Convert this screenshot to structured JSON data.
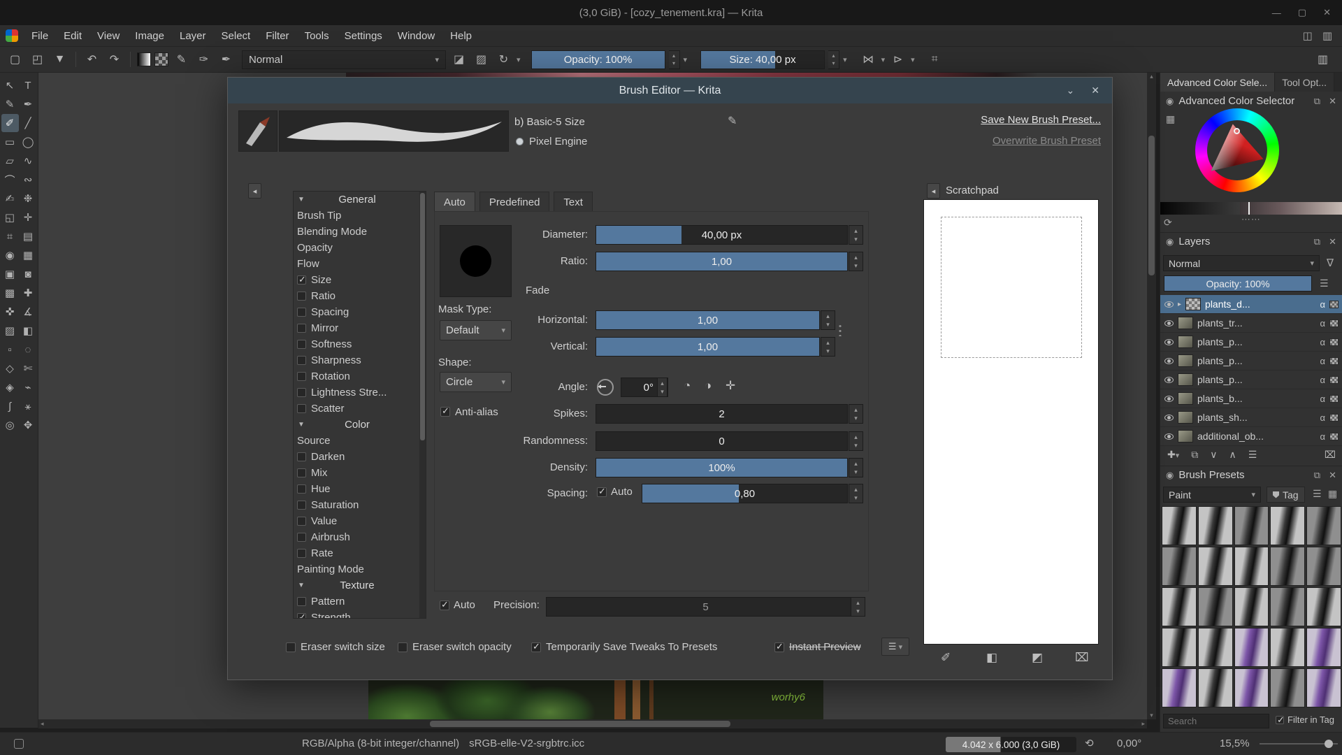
{
  "colors": {
    "accent_blue": "#54789e",
    "selection_blue": "#4a6d8e",
    "dialog_titlebar": "#35444e"
  },
  "window": {
    "title": "(3,0 GiB) - [cozy_tenement.kra] — Krita"
  },
  "menu_bar": {
    "items": [
      "File",
      "Edit",
      "View",
      "Image",
      "Layer",
      "Select",
      "Filter",
      "Tools",
      "Settings",
      "Window",
      "Help"
    ]
  },
  "toolbar": {
    "blending_mode_value": "Normal",
    "opacity_slider": "Opacity: 100%",
    "size_slider": "Size: 40,00 px"
  },
  "toolbox": {
    "tools": [
      {
        "name": "select-shapes",
        "glyph": "↖"
      },
      {
        "name": "text",
        "glyph": "T"
      },
      {
        "name": "edit-shapes",
        "glyph": "✎"
      },
      {
        "name": "calligraphy",
        "glyph": "✒"
      },
      {
        "name": "freehand-brush",
        "glyph": "✐",
        "selected": true
      },
      {
        "name": "line",
        "glyph": "╱"
      },
      {
        "name": "rectangle",
        "glyph": "▭"
      },
      {
        "name": "ellipse",
        "glyph": "◯"
      },
      {
        "name": "polygon",
        "glyph": "▱"
      },
      {
        "name": "polyline",
        "glyph": "∿"
      },
      {
        "name": "bezier-curve",
        "glyph": "⌒"
      },
      {
        "name": "freehand-path",
        "glyph": "∾"
      },
      {
        "name": "dynamic-brush",
        "glyph": "✍"
      },
      {
        "name": "multibrush",
        "glyph": "❉"
      },
      {
        "name": "transform",
        "glyph": "◱"
      },
      {
        "name": "move",
        "glyph": "✛"
      },
      {
        "name": "crop",
        "glyph": "⌗"
      },
      {
        "name": "gradient",
        "glyph": "▤"
      },
      {
        "name": "color-sampler",
        "glyph": "◉"
      },
      {
        "name": "pattern-edit",
        "glyph": "▦"
      },
      {
        "name": "fill",
        "glyph": "▣"
      },
      {
        "name": "enclose-fill",
        "glyph": "◙"
      },
      {
        "name": "colorize-mask",
        "glyph": "▩"
      },
      {
        "name": "smart-patch",
        "glyph": "✚"
      },
      {
        "name": "assistants",
        "glyph": "✜"
      },
      {
        "name": "measure",
        "glyph": "∡"
      },
      {
        "name": "reference-images",
        "glyph": "▨"
      },
      {
        "name": "lazy-fill",
        "glyph": "◧"
      },
      {
        "name": "rect-select",
        "glyph": "▫"
      },
      {
        "name": "ellipse-select",
        "glyph": "◌"
      },
      {
        "name": "polygon-select",
        "glyph": "◇"
      },
      {
        "name": "freehand-select",
        "glyph": "✄"
      },
      {
        "name": "similar-select",
        "glyph": "◈"
      },
      {
        "name": "magnetic-select",
        "glyph": "⌁"
      },
      {
        "name": "bezier-select",
        "glyph": "∫"
      },
      {
        "name": "contiguous-select",
        "glyph": "⚹"
      },
      {
        "name": "zoom",
        "glyph": "◎"
      },
      {
        "name": "pan",
        "glyph": "✥"
      }
    ]
  },
  "canvas": {
    "signature": "worhy6"
  },
  "dialog": {
    "title": "Brush Editor — Krita",
    "preset_name": "b) Basic-5 Size",
    "engine_label": "Pixel Engine",
    "save_new_button": "Save New Brush Preset...",
    "overwrite_button": "Overwrite Brush Preset",
    "options": [
      {
        "type": "header",
        "label": "General"
      },
      {
        "type": "item",
        "label": "Brush Tip",
        "checkbox": false
      },
      {
        "type": "item",
        "label": "Blending Mode",
        "checkbox": false
      },
      {
        "type": "item",
        "label": "Opacity",
        "checkbox": false
      },
      {
        "type": "item",
        "label": "Flow",
        "checkbox": false
      },
      {
        "type": "item",
        "label": "Size",
        "checkbox": true,
        "checked": true
      },
      {
        "type": "item",
        "label": "Ratio",
        "checkbox": true,
        "checked": false
      },
      {
        "type": "item",
        "label": "Spacing",
        "checkbox": true,
        "checked": false
      },
      {
        "type": "item",
        "label": "Mirror",
        "checkbox": true,
        "checked": false
      },
      {
        "type": "item",
        "label": "Softness",
        "checkbox": true,
        "checked": false
      },
      {
        "type": "item",
        "label": "Sharpness",
        "checkbox": true,
        "checked": false
      },
      {
        "type": "item",
        "label": "Rotation",
        "checkbox": true,
        "checked": false
      },
      {
        "type": "item",
        "label": "Lightness Stre...",
        "checkbox": true,
        "checked": false
      },
      {
        "type": "item",
        "label": "Scatter",
        "checkbox": true,
        "checked": false
      },
      {
        "type": "header",
        "label": "Color"
      },
      {
        "type": "item",
        "label": "Source",
        "checkbox": false
      },
      {
        "type": "item",
        "label": "Darken",
        "checkbox": true,
        "checked": false
      },
      {
        "type": "item",
        "label": "Mix",
        "checkbox": true,
        "checked": false
      },
      {
        "type": "item",
        "label": "Hue",
        "checkbox": true,
        "checked": false
      },
      {
        "type": "item",
        "label": "Saturation",
        "checkbox": true,
        "checked": false
      },
      {
        "type": "item",
        "label": "Value",
        "checkbox": true,
        "checked": false
      },
      {
        "type": "item",
        "label": "Airbrush",
        "checkbox": true,
        "checked": false
      },
      {
        "type": "item",
        "label": "Rate",
        "checkbox": true,
        "checked": false
      },
      {
        "type": "item",
        "label": "Painting Mode",
        "checkbox": false
      },
      {
        "type": "header",
        "label": "Texture"
      },
      {
        "type": "item",
        "label": "Pattern",
        "checkbox": true,
        "checked": false
      },
      {
        "type": "item",
        "label": "Strength",
        "checkbox": true,
        "checked": true
      }
    ],
    "tabs": [
      {
        "label": "Auto",
        "selected": true
      },
      {
        "label": "Predefined",
        "selected": false
      },
      {
        "label": "Text",
        "selected": false
      }
    ],
    "params": {
      "diameter_label": "Diameter:",
      "diameter_value": "40,00 px",
      "ratio_label": "Ratio:",
      "ratio_value": "1,00",
      "fade_label": "Fade",
      "mask_type_label": "Mask Type:",
      "mask_type_value": "Default",
      "horizontal_label": "Horizontal:",
      "horizontal_value": "1,00",
      "vertical_label": "Vertical:",
      "vertical_value": "1,00",
      "shape_label": "Shape:",
      "shape_value": "Circle",
      "angle_label": "Angle:",
      "angle_value": "0°",
      "antialias_label": "Anti-alias",
      "spikes_label": "Spikes:",
      "spikes_value": "2",
      "randomness_label": "Randomness:",
      "randomness_value": "0",
      "density_label": "Density:",
      "density_value": "100%",
      "spacing_label": "Spacing:",
      "spacing_auto_label": "Auto",
      "spacing_value": "0,80",
      "auto_label": "Auto",
      "precision_label": "Precision:",
      "precision_value": "5"
    },
    "footer": {
      "eraser_switch_size": "Eraser switch size",
      "eraser_switch_opacity": "Eraser switch opacity",
      "save_tweaks": "Temporarily Save Tweaks To Presets",
      "instant_preview": "Instant Preview"
    },
    "scratchpad": {
      "title": "Scratchpad"
    }
  },
  "dockers": {
    "tabs": [
      {
        "label": "Advanced Color Sele...",
        "selected": true
      },
      {
        "label": "Tool Opt...",
        "selected": false
      }
    ],
    "color_selector": {
      "title": "Advanced Color Selector"
    },
    "layers": {
      "title": "Layers",
      "blending_mode_value": "Normal",
      "opacity_slider": "Opacity: 100%",
      "rows": [
        {
          "name": "plants_d...",
          "selected": true,
          "group": true
        },
        {
          "name": "plants_tr..."
        },
        {
          "name": "plants_p..."
        },
        {
          "name": "plants_p..."
        },
        {
          "name": "plants_p..."
        },
        {
          "name": "plants_b..."
        },
        {
          "name": "plants_sh..."
        },
        {
          "name": "additional_ob..."
        }
      ]
    },
    "brush_presets": {
      "title": "Brush Presets",
      "filter_value": "Paint",
      "tag_label": "Tag",
      "search_placeholder": "Search",
      "filter_in_tag_label": "Filter in Tag",
      "tiles": [
        "gray",
        "gray",
        "dark",
        "gray",
        "dark",
        "dark",
        "gray",
        "gray",
        "dark",
        "dark",
        "gray",
        "dark",
        "gray",
        "dark",
        "gray",
        "gray",
        "gray",
        "purple",
        "gray",
        "purple",
        "purple",
        "gray",
        "purple",
        "dark",
        "purple"
      ]
    }
  },
  "status_bar": {
    "color_mode": "RGB/Alpha (8-bit integer/channel)",
    "profile": "sRGB-elle-V2-srgbtrc.icc",
    "memory": "4.042 x 6.000 (3,0 GiB)",
    "rotation": "0,00°",
    "zoom": "15,5%"
  }
}
